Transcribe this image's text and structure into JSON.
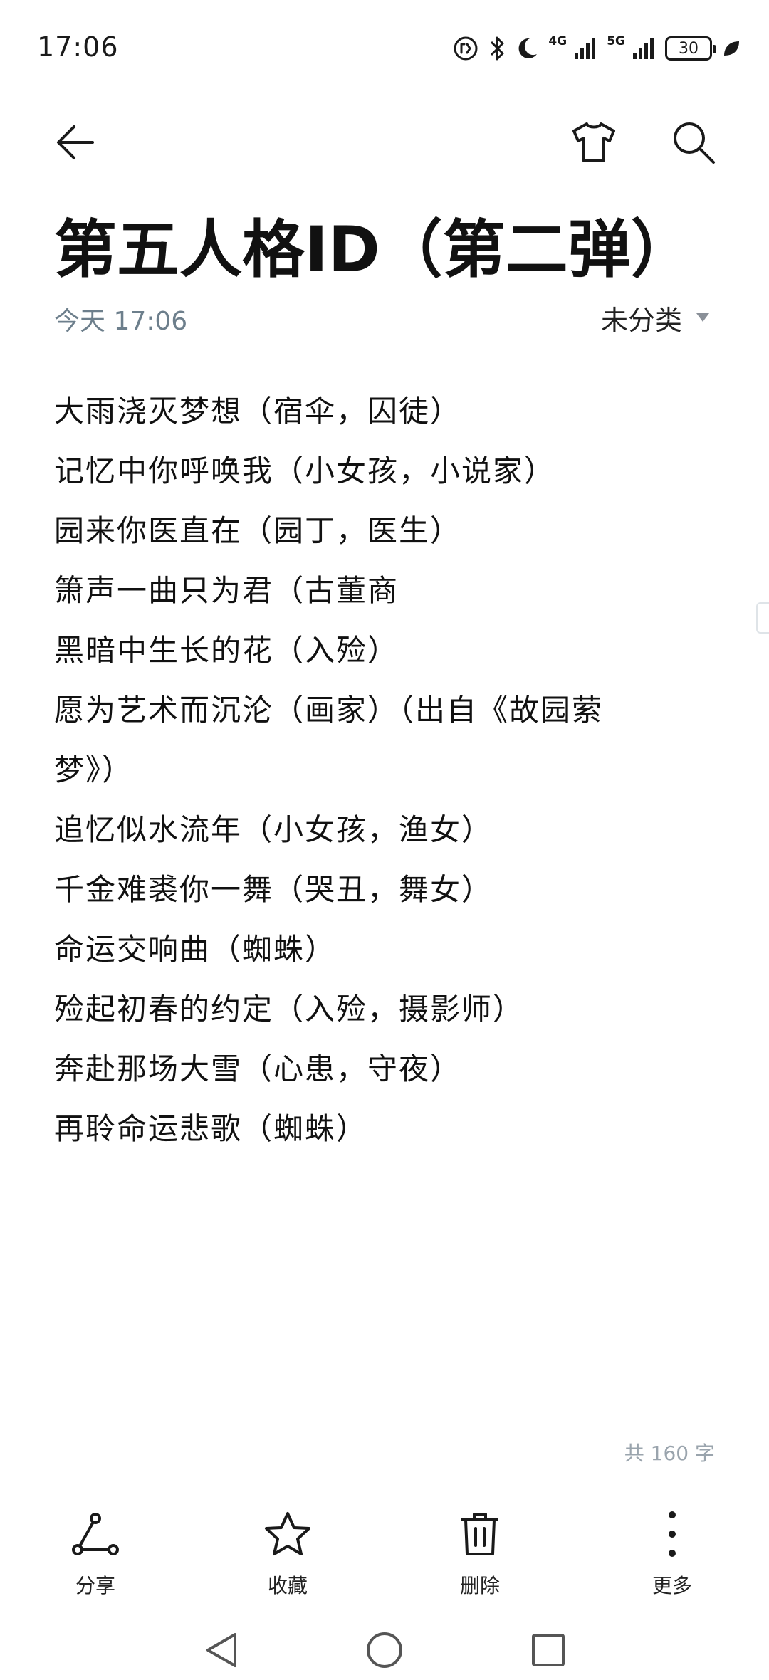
{
  "status_bar": {
    "time": "17:06",
    "network_4g": "4G",
    "network_5g": "5G",
    "battery": "30"
  },
  "toolbar": {
    "back_icon": "arrow-left-icon",
    "theme_icon": "tshirt-icon",
    "search_icon": "search-icon"
  },
  "note": {
    "title": "第五人格ID（第二弹）",
    "date": "今天 17:06",
    "category": "未分类",
    "lines": [
      "大雨浇灭梦想（宿伞，囚徒）",
      "记忆中你呼唤我（小女孩，小说家）",
      "园来你医直在（园丁，医生）",
      "箫声一曲只为君（古董商",
      "黑暗中生长的花（入殓）",
      "愿为艺术而沉沦（画家）（出自《故园萦",
      "梦》）",
      "追忆似水流年（小女孩，渔女）",
      "千金难裘你一舞（哭丑，舞女）",
      "命运交响曲（蜘蛛）",
      "殓起初春的约定（入殓，摄影师）",
      "奔赴那场大雪（心患，守夜）",
      "再聆命运悲歌（蜘蛛）"
    ],
    "word_count": "共 160 字"
  },
  "actions": [
    {
      "label": "分享",
      "icon": "share-icon"
    },
    {
      "label": "收藏",
      "icon": "star-icon"
    },
    {
      "label": "删除",
      "icon": "trash-icon"
    },
    {
      "label": "更多",
      "icon": "more-vertical-icon"
    }
  ],
  "nav": {
    "back_icon": "nav-back-triangle-icon",
    "home_icon": "nav-home-circle-icon",
    "recent_icon": "nav-recents-square-icon"
  },
  "colors": {
    "text": "#111111",
    "meta": "#6d7f8c",
    "muted": "#9aa4ad",
    "background": "#ffffff"
  }
}
